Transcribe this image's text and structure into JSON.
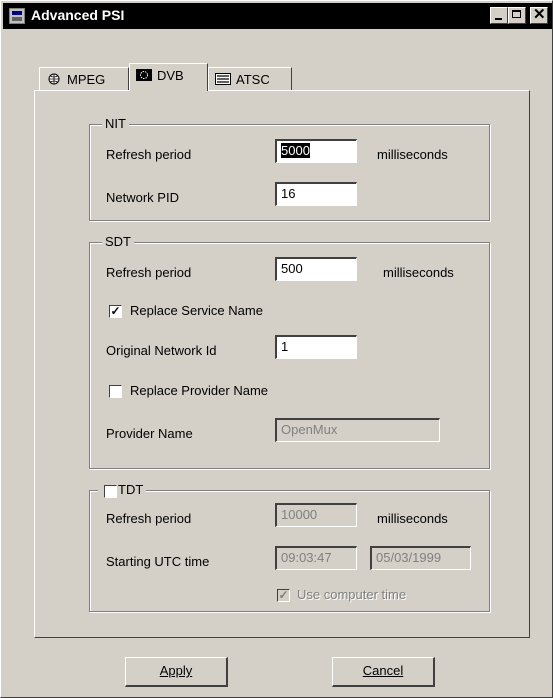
{
  "window": {
    "title": "Advanced PSI"
  },
  "tabs": [
    {
      "label": "MPEG",
      "icon": "globe-icon",
      "active": false
    },
    {
      "label": "DVB",
      "icon": "dvb-icon",
      "active": true
    },
    {
      "label": "ATSC",
      "icon": "atsc-icon",
      "active": false
    }
  ],
  "nit": {
    "legend": "NIT",
    "refresh_label": "Refresh period",
    "refresh_value": "5000",
    "refresh_unit": "milliseconds",
    "pid_label": "Network PID",
    "pid_value": "16"
  },
  "sdt": {
    "legend": "SDT",
    "refresh_label": "Refresh period",
    "refresh_value": "500",
    "refresh_unit": "milliseconds",
    "replace_service_label": "Replace Service Name",
    "replace_service_checked": true,
    "onid_label": "Original Network Id",
    "onid_value": "1",
    "replace_provider_label": "Replace Provider Name",
    "replace_provider_checked": false,
    "provider_label": "Provider Name",
    "provider_value": "OpenMux"
  },
  "tdt": {
    "legend": "TDT",
    "enabled": false,
    "refresh_label": "Refresh period",
    "refresh_value": "10000",
    "refresh_unit": "milliseconds",
    "start_label": "Starting UTC time",
    "time_value": "09:03:47",
    "date_value": "05/03/1999",
    "use_computer_time_label": "Use computer time",
    "use_computer_time_checked": true
  },
  "buttons": {
    "apply_label": "Apply",
    "cancel_label": "Cancel"
  },
  "colors": {
    "face": "#d4d0c8",
    "titlebar": "#000000",
    "disabled_text": "#808080"
  }
}
